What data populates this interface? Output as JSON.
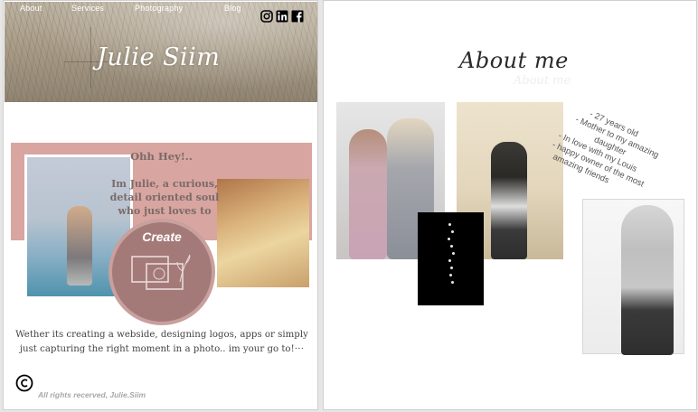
{
  "left_page": {
    "nav": {
      "items": [
        "About",
        "Services",
        "Photography",
        "Blog"
      ]
    },
    "social": [
      "instagram-icon",
      "linkedin-icon",
      "facebook-icon"
    ],
    "brand": "Julie Siim",
    "intro": {
      "title": "Ohh Hey!..",
      "text": "Im Julie, a curious, detail oriented soul who just loves to",
      "create_label": "Create"
    },
    "body_text": "Wether its creating a webside, designing logos, apps or simply just capturing the right moment in a photo.. im your go to!⋅⋅⋅",
    "copyright": "All rights recerved, Julie.Siim"
  },
  "right_page": {
    "title": "About me",
    "title_echo": "About me",
    "facts": [
      "- 27 years old",
      "- Mother to my amazing",
      "daughter",
      "- In love with my Louis",
      "- happy owner of the most",
      "amazing friends"
    ]
  },
  "colors": {
    "accent_pink": "#d8a5a0",
    "create_circle": "#a47a79",
    "text_brown": "#7b6a68"
  }
}
